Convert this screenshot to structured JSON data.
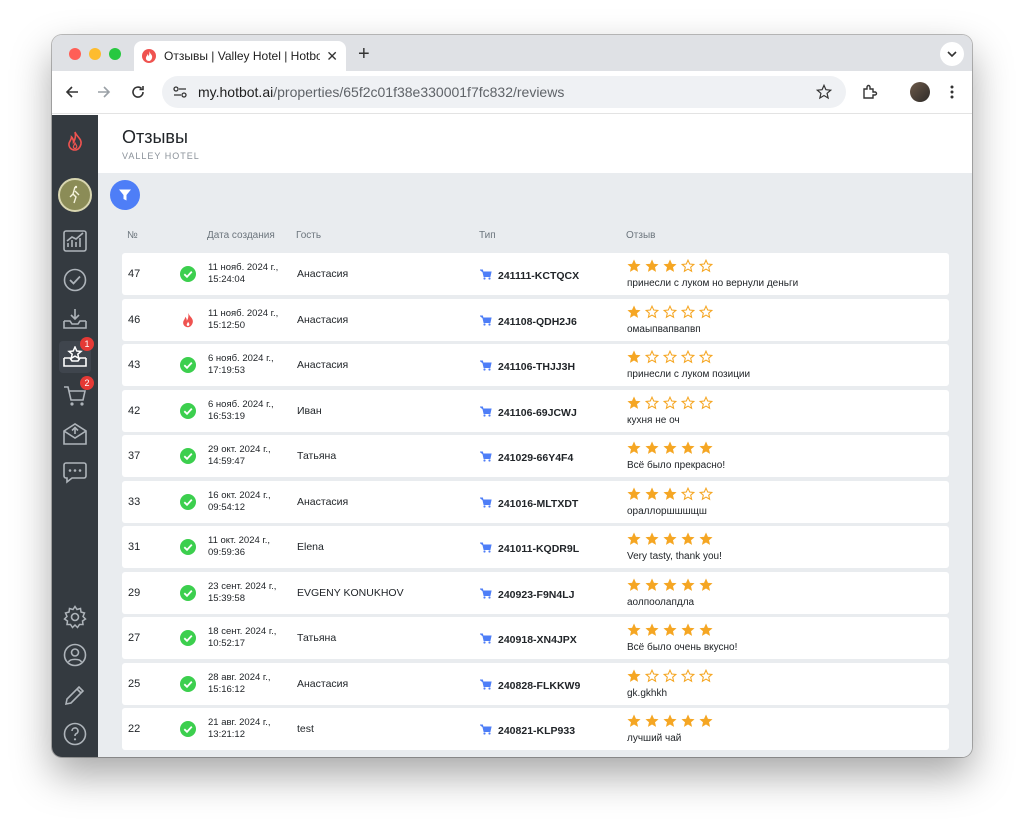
{
  "browser": {
    "tab_title": "Отзывы | Valley Hotel | Hotbot",
    "url_host": "my.hotbot.ai",
    "url_path": "/properties/65f2c01f38e330001f7fc832/reviews"
  },
  "sidebar": {
    "reviews_badge": "1",
    "orders_badge": "2"
  },
  "page": {
    "title": "Отзывы",
    "subtitle": "VALLEY HOTEL"
  },
  "columns": {
    "num": "№",
    "created": "Дата создания",
    "guest": "Гость",
    "type": "Тип",
    "review": "Отзыв"
  },
  "colors": {
    "star": "#f5a623",
    "ok": "#3ccf4e",
    "flame": "#ef5350",
    "cart": "#4e7ef7",
    "sidebar": "#343a40",
    "filter": "#4e7ef7"
  },
  "reviews": [
    {
      "num": "47",
      "status": "ok",
      "date1": "11 нояб. 2024 г.,",
      "date2": "15:24:04",
      "guest": "Анастасия",
      "code": "241111-KCTQCX",
      "rating": 3,
      "text": "принесли с луком но вернули деньги"
    },
    {
      "num": "46",
      "status": "flame",
      "date1": "11 нояб. 2024 г.,",
      "date2": "15:12:50",
      "guest": "Анастасия",
      "code": "241108-QDH2J6",
      "rating": 1,
      "text": "омаыпвапвапвп"
    },
    {
      "num": "43",
      "status": "ok",
      "date1": "6 нояб. 2024 г.,",
      "date2": "17:19:53",
      "guest": "Анастасия",
      "code": "241106-THJJ3H",
      "rating": 1,
      "text": "принесли с луком позиции"
    },
    {
      "num": "42",
      "status": "ok",
      "date1": "6 нояб. 2024 г.,",
      "date2": "16:53:19",
      "guest": "Иван",
      "code": "241106-69JCWJ",
      "rating": 1,
      "text": "кухня не оч"
    },
    {
      "num": "37",
      "status": "ok",
      "date1": "29 окт. 2024 г.,",
      "date2": "14:59:47",
      "guest": "Татьяна",
      "code": "241029-66Y4F4",
      "rating": 5,
      "text": "Всё было прекрасно!"
    },
    {
      "num": "33",
      "status": "ok",
      "date1": "16 окт. 2024 г.,",
      "date2": "09:54:12",
      "guest": "Анастасия",
      "code": "241016-MLTXDT",
      "rating": 3,
      "text": "ораллоршшшщш"
    },
    {
      "num": "31",
      "status": "ok",
      "date1": "11 окт. 2024 г.,",
      "date2": "09:59:36",
      "guest": "Elena",
      "code": "241011-KQDR9L",
      "rating": 5,
      "text": "Very tasty, thank you!"
    },
    {
      "num": "29",
      "status": "ok",
      "date1": "23 сент. 2024 г.,",
      "date2": "15:39:58",
      "guest": "EVGENY KONUKHOV",
      "code": "240923-F9N4LJ",
      "rating": 5,
      "text": "аолпоолапдла"
    },
    {
      "num": "27",
      "status": "ok",
      "date1": "18 сент. 2024 г.,",
      "date2": "10:52:17",
      "guest": "Татьяна",
      "code": "240918-XN4JPX",
      "rating": 5,
      "text": "Всё было очень вкусно!"
    },
    {
      "num": "25",
      "status": "ok",
      "date1": "28 авг. 2024 г.,",
      "date2": "15:16:12",
      "guest": "Анастасия",
      "code": "240828-FLKKW9",
      "rating": 1,
      "text": "gk.gkhkh"
    },
    {
      "num": "22",
      "status": "ok",
      "date1": "21 авг. 2024 г.,",
      "date2": "13:21:12",
      "guest": "test",
      "code": "240821-KLP933",
      "rating": 5,
      "text": "лучший чай"
    }
  ]
}
